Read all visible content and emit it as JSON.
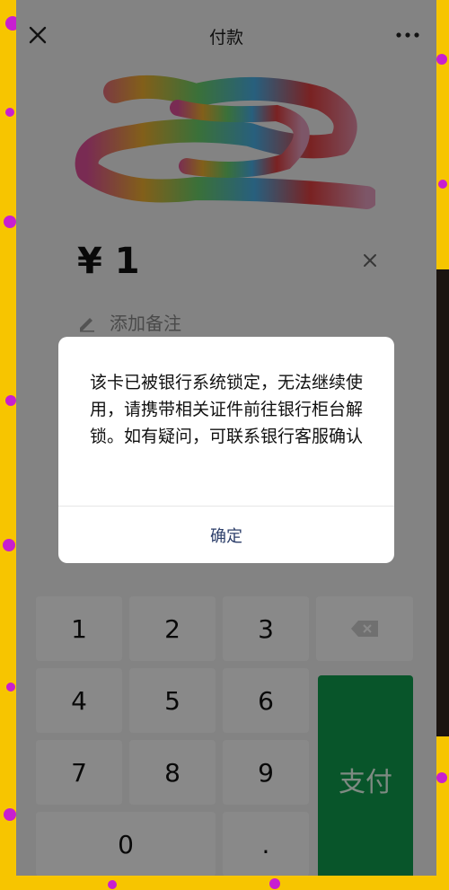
{
  "header": {
    "title": "付款",
    "close_icon": "close-icon",
    "more_icon": "more-dots-icon"
  },
  "payment": {
    "amount": "¥ 1",
    "note_label": "添加备注"
  },
  "keypad": {
    "keys": [
      "1",
      "2",
      "3",
      "4",
      "5",
      "6",
      "7",
      "8",
      "9",
      "0",
      "."
    ],
    "pay_label": "支付",
    "backspace_icon": "backspace-icon"
  },
  "dialog": {
    "message": "该卡已被银行系统锁定，无法继续使用，请携带相关证件前往银行柜台解锁。如有疑问，可联系银行客服确认",
    "confirm_label": "确定"
  },
  "colors": {
    "frame": "#f7c500",
    "pay_green": "#0f9d4f",
    "dot": "#c81fd0"
  }
}
